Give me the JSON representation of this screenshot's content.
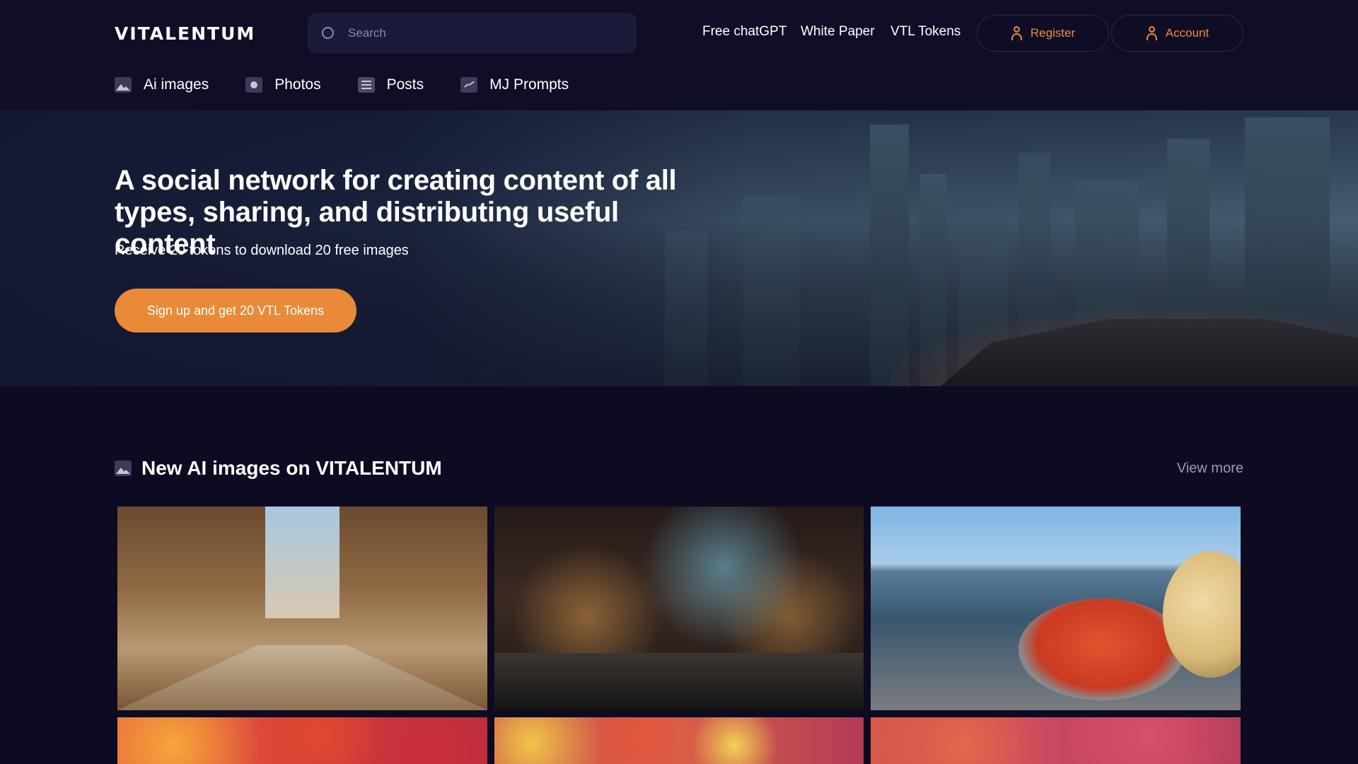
{
  "header": {
    "logo": "VITALENTUM",
    "search_placeholder": "Search",
    "links": [
      "Free chatGPT",
      "White Paper",
      "VTL Tokens"
    ],
    "register_label": "Register",
    "account_label": "Account",
    "accent_color": "#f08a3c"
  },
  "categories": [
    {
      "label": "Ai images",
      "icon": "image-icon"
    },
    {
      "label": "Photos",
      "icon": "photo-icon"
    },
    {
      "label": "Posts",
      "icon": "posts-icon"
    },
    {
      "label": "MJ Prompts",
      "icon": "prompt-icon"
    }
  ],
  "hero": {
    "title": "A social network for creating content of all types, sharing, and distributing useful content",
    "subtitle": "Receive 20 tokens to download 20 free images",
    "cta_label": "Sign up and get 20 VTL Tokens",
    "cta_color": "#e98a38"
  },
  "section": {
    "title": "New AI images on VITALENTUM",
    "view_more": "View more",
    "icon": "image-icon"
  },
  "gallery": [
    {
      "name": "gallery-image-market-street"
    },
    {
      "name": "gallery-image-night-bazaar"
    },
    {
      "name": "gallery-image-seaside-crayfish"
    },
    {
      "name": "gallery-image-autumn-leaves"
    },
    {
      "name": "gallery-image-autumn-leaves"
    },
    {
      "name": "gallery-image-autumn-leaves"
    }
  ]
}
